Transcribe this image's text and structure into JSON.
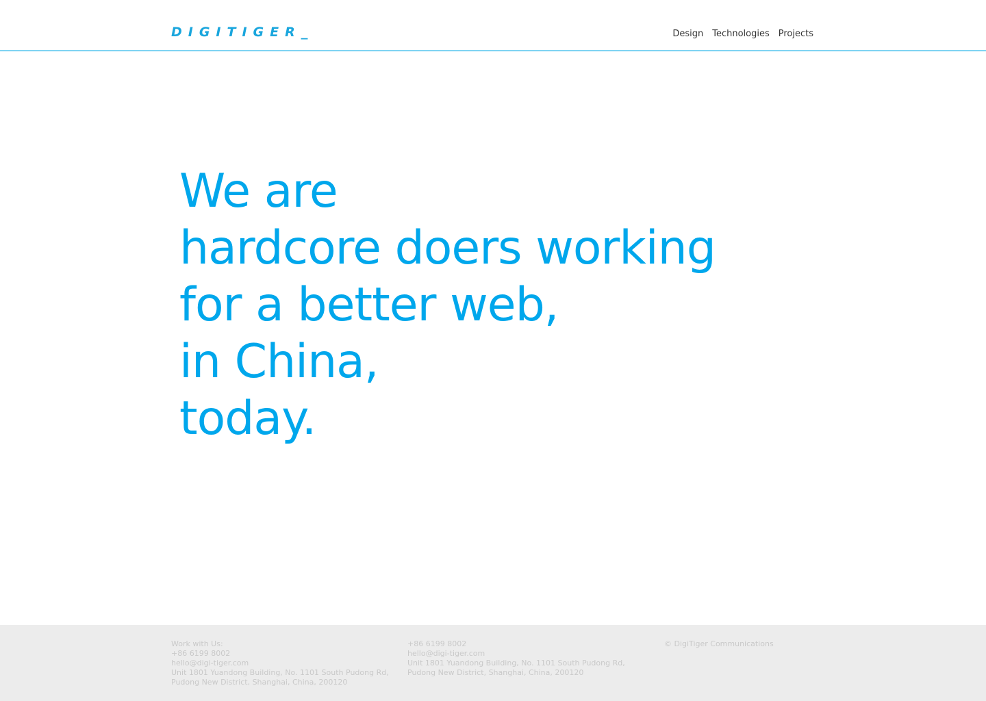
{
  "header": {
    "logo_text": "DIGITIGER_",
    "nav": [
      {
        "label": "Design"
      },
      {
        "label": "Technologies"
      },
      {
        "label": "Projects"
      }
    ]
  },
  "hero": {
    "lines": [
      "We are",
      "hardcore doers working",
      "for a better web,",
      "in China,",
      "today."
    ]
  },
  "footer": {
    "col1": {
      "heading": "Work with Us:",
      "phone": "+86 6199 8002",
      "email": "hello@digi-tiger.com",
      "address_line1": "Unit 1801 Yuandong Building, No. 1101 South Pudong Rd,",
      "address_line2": "Pudong New District, Shanghai, China, 200120"
    },
    "col2": {
      "phone": "+86 6199 8002",
      "email": "hello@digi-tiger.com",
      "address_line1": "Unit 1801 Yuandong Building, No. 1101 South Pudong Rd,",
      "address_line2": "Pudong New District, Shanghai, China, 200120"
    },
    "copyright": "© DigiTiger Communications"
  },
  "colors": {
    "accent": "#00a7ec",
    "logo": "#1aa6dd",
    "header_rule": "#7fd3f2",
    "footer_bg": "#ececec",
    "footer_text": "#c9c9c9",
    "nav_text": "#333333"
  }
}
